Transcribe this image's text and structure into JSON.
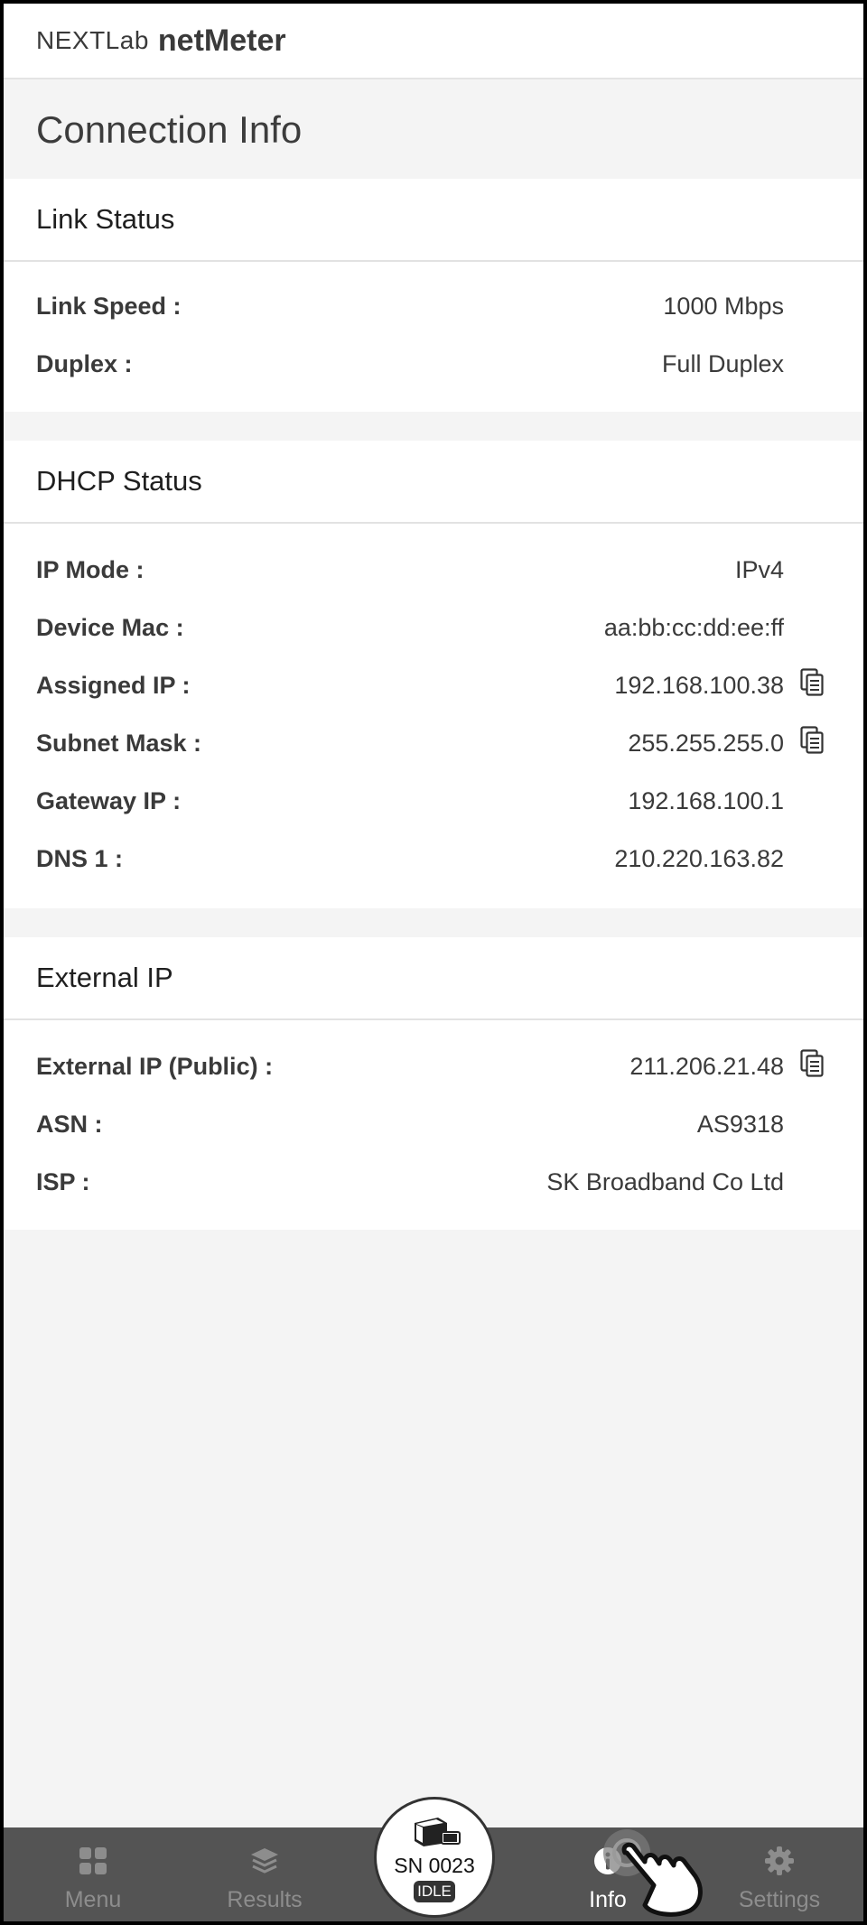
{
  "header": {
    "brand_prefix": "NEXTLab",
    "brand_name": "netMeter"
  },
  "page": {
    "title": "Connection Info"
  },
  "link_status": {
    "title": "Link Status",
    "rows": [
      {
        "label": "Link Speed :",
        "value": "1000 Mbps"
      },
      {
        "label": "Duplex :",
        "value": "Full Duplex"
      }
    ]
  },
  "dhcp_status": {
    "title": "DHCP Status",
    "rows": [
      {
        "label": "IP Mode :",
        "value": "IPv4"
      },
      {
        "label": "Device Mac :",
        "value": "aa:bb:cc:dd:ee:ff"
      },
      {
        "label": "Assigned IP :",
        "value": "192.168.100.38"
      },
      {
        "label": "Subnet Mask :",
        "value": "255.255.255.0"
      },
      {
        "label": "Gateway IP :",
        "value": "192.168.100.1"
      },
      {
        "label": "DNS 1 :",
        "value": "210.220.163.82"
      }
    ]
  },
  "external_ip": {
    "title": "External IP",
    "rows": [
      {
        "label": "External IP (Public) :",
        "value": "211.206.21.48"
      },
      {
        "label": "ASN :",
        "value": "AS9318"
      },
      {
        "label": "ISP :",
        "value": "SK Broadband Co Ltd"
      }
    ]
  },
  "tabbar": {
    "menu_label": "Menu",
    "results_label": "Results",
    "info_label": "Info",
    "settings_label": "Settings",
    "active_tab": "Info"
  },
  "device": {
    "serial": "SN 0023",
    "state": "IDLE"
  },
  "icons": {
    "copy": "copy-icon",
    "menu": "grid-icon",
    "results": "layers-icon",
    "info": "info-icon",
    "settings": "gear-icon",
    "device": "device-battery-icon",
    "pointer": "hand-pointer-icon"
  },
  "colors": {
    "tabbar_bg": "#545454",
    "tab_inactive": "#8d8d8d",
    "tab_active": "#ffffff",
    "page_bg": "#f4f4f4"
  }
}
